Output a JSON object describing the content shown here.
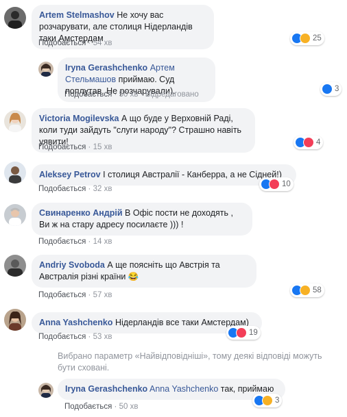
{
  "comments": [
    {
      "author": "Artem Stelmashov",
      "text": "Не хочу вас розчарувати, але столиця Нідерландів таки Амстердам",
      "like": "Подобається",
      "time": "54 хв",
      "reactions": "25"
    },
    {
      "author": "Iryna Gerashchenko",
      "mention": "Артем Стельмашов",
      "text": "приймаю. Суд поплутав. Не розчарували).",
      "like": "Подобається",
      "time": "50 хв",
      "edited": "Відредаговано",
      "reactions": "3"
    },
    {
      "author": "Victoria Mogilevska",
      "text": "А що буде у Верховній Раді, коли туди зайдуть \"слуги народу\"? Страшно навіть уявити!",
      "like": "Подобається",
      "time": "15 хв",
      "reactions": "4"
    },
    {
      "author": "Aleksey Petrov",
      "text": "І столиця Австралії - Канберра, а не Сідней!)",
      "like": "Подобається",
      "time": "32 хв",
      "reactions": "10"
    },
    {
      "author": "Свинаренко Андрій",
      "text": "В Офіс пости не доходять , Ви ж на стару адресу посилаєте ))) !",
      "like": "Подобається",
      "time": "14 хв"
    },
    {
      "author": "Andriy Svoboda",
      "text": "А ще поясніть що Австрія та Австралія різні країни",
      "emoji": "😂",
      "like": "Подобається",
      "time": "57 хв",
      "reactions": "58"
    },
    {
      "author": "Anna Yashchenko",
      "text": "Нідерландів все таки Амстердам)",
      "like": "Подобається",
      "time": "53 хв",
      "reactions": "19"
    },
    {
      "author": "Iryna Gerashchenko",
      "mention": "Anna Yashchenko",
      "text": "так, приймаю",
      "like": "Подобається",
      "time": "50 хв",
      "reactions": "3"
    }
  ],
  "notice": "Вибрано параметр «Найвідповідніші», тому деякі відповіді можуть бути сховані.",
  "separator": "·",
  "colors": {
    "link": "#385898",
    "bubble": "#f2f3f5",
    "like": "#1877f2",
    "love": "#f33e58",
    "haha": "#f7b125"
  }
}
